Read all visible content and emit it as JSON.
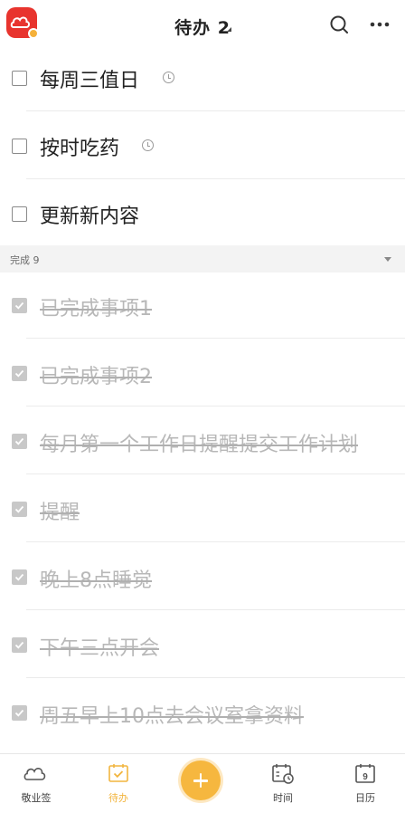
{
  "header": {
    "title": "待办 2",
    "app_logo_icon": "cloud-note-logo-icon",
    "search_icon": "search-icon",
    "more_icon": "more-dots-icon"
  },
  "tasks": [
    {
      "label": "每周三值日",
      "has_reminder": true
    },
    {
      "label": "按时吃药",
      "has_reminder": true
    },
    {
      "label": "更新新内容",
      "has_reminder": false
    }
  ],
  "completed_section": {
    "label": "完成 9",
    "caret_icon": "triangle-down-icon"
  },
  "completed_tasks": [
    {
      "label": "已完成事项1"
    },
    {
      "label": "已完成事项2"
    },
    {
      "label": "每月第一个工作日提醒提交工作计划"
    },
    {
      "label": "提醒"
    },
    {
      "label": "晚上8点睡觉"
    },
    {
      "label": "下午三点开会"
    },
    {
      "label": "周五早上10点去会议室拿资料"
    }
  ],
  "tabbar": {
    "tabs": [
      {
        "label": "敬业签",
        "icon": "cloud-icon"
      },
      {
        "label": "待办",
        "icon": "todo-calendar-check-icon",
        "active": true
      },
      {
        "label": "",
        "icon": "plus-icon"
      },
      {
        "label": "时间",
        "icon": "calendar-clock-icon"
      },
      {
        "label": "日历",
        "icon": "calendar-icon",
        "day": "9"
      }
    ]
  },
  "colors": {
    "accent": "#f6b73f",
    "logo": "#e8342e",
    "section_bg": "#f3f3f3",
    "done_text": "#b8b8b8"
  }
}
